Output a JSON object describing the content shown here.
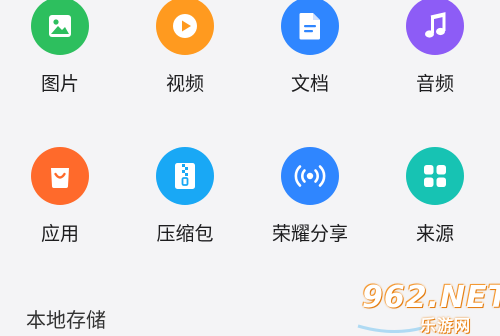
{
  "categories": [
    {
      "label": "图片",
      "icon": "image-icon",
      "color": "#2dbf5e"
    },
    {
      "label": "视频",
      "icon": "video-play-icon",
      "color": "#ff9a1f"
    },
    {
      "label": "文档",
      "icon": "document-icon",
      "color": "#2f86ff"
    },
    {
      "label": "音频",
      "icon": "music-note-icon",
      "color": "#8d5cf6"
    },
    {
      "label": "应用",
      "icon": "shopping-bag-icon",
      "color": "#ff6a2b"
    },
    {
      "label": "压缩包",
      "icon": "zip-archive-icon",
      "color": "#19a8f5"
    },
    {
      "label": "荣耀分享",
      "icon": "wireless-share-icon",
      "color": "#2f86ff"
    },
    {
      "label": "来源",
      "icon": "apps-grid-icon",
      "color": "#17c3b3"
    }
  ],
  "section": {
    "title": "本地存储"
  },
  "watermark": {
    "main": "962.NET",
    "sub": "乐游网"
  }
}
